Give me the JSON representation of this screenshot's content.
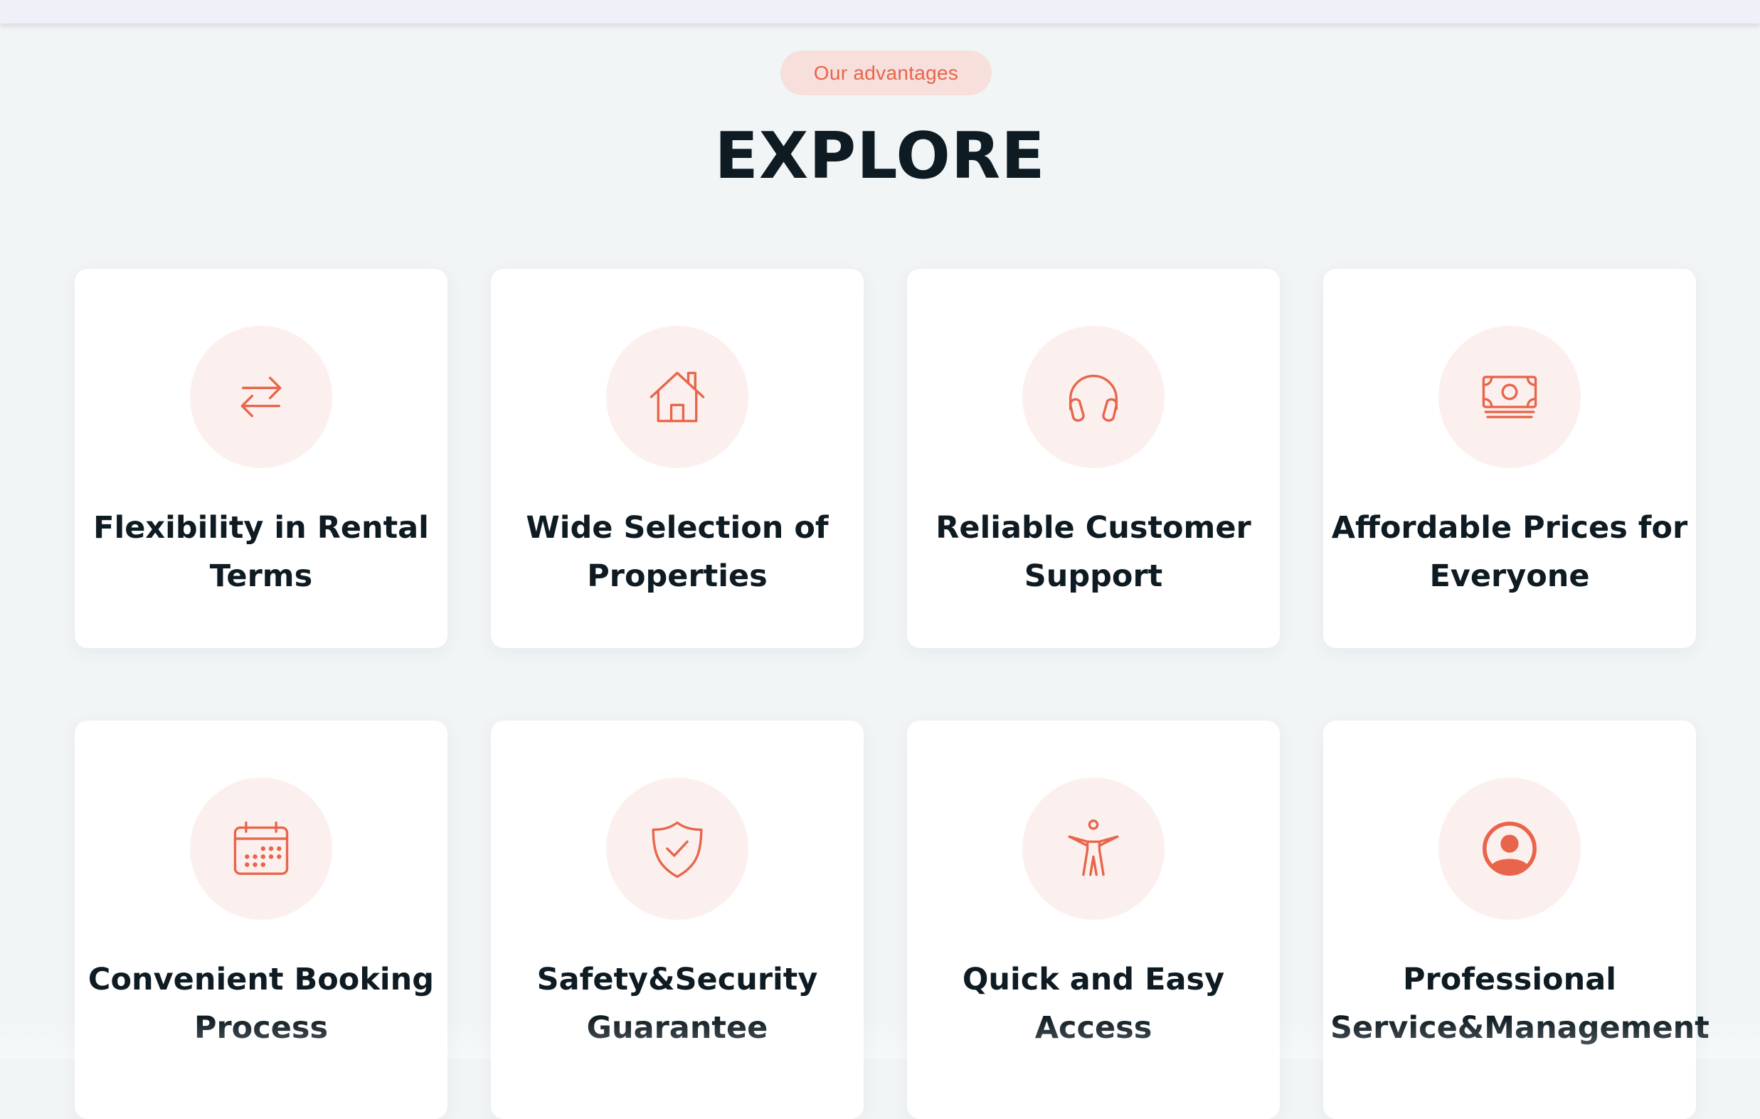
{
  "section": {
    "badge": "Our advantages",
    "title": "EXPLORE"
  },
  "accent_color": "#e8654b",
  "cards": [
    {
      "title": "Flexibility in Rental Terms",
      "icon": "arrows-exchange-icon"
    },
    {
      "title": "Wide Selection of Properties",
      "icon": "house-icon"
    },
    {
      "title": "Reliable Customer Support",
      "icon": "headphones-icon"
    },
    {
      "title": "Affordable Prices for Everyone",
      "icon": "banknote-icon"
    },
    {
      "title": "Convenient Booking Process",
      "icon": "calendar-icon"
    },
    {
      "title": "Safety&Security Guarantee",
      "icon": "shield-check-icon"
    },
    {
      "title": "Quick and Easy Access",
      "icon": "accessibility-icon"
    },
    {
      "title": "Professional Service&Management",
      "icon": "user-circle-icon"
    }
  ]
}
